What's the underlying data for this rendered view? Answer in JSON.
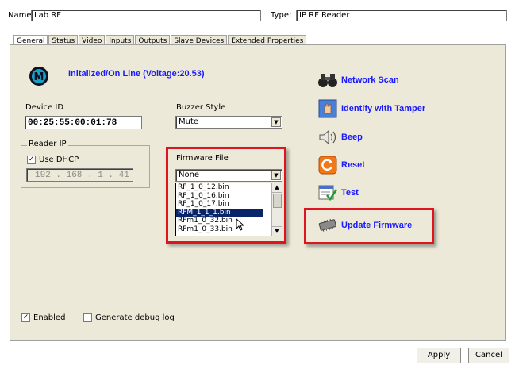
{
  "header": {
    "name_label": "Name:",
    "name_value": "Lab RF",
    "type_label": "Type:",
    "type_value": "IP RF Reader"
  },
  "tabs": [
    "General",
    "Status",
    "Video",
    "Inputs",
    "Outputs",
    "Slave Devices",
    "Extended Properties"
  ],
  "status": {
    "text": "Initalized/On Line (Voltage:20.53)"
  },
  "device": {
    "id_label": "Device ID",
    "id_value": "00:25:55:00:01:78",
    "reader_ip_label": "Reader IP",
    "dhcp_label": "Use DHCP",
    "dhcp_checked": true,
    "ip_value": "192 . 168 . 1 . 41"
  },
  "buzzer": {
    "label": "Buzzer Style",
    "value": "Mute"
  },
  "firmware": {
    "label": "Firmware File",
    "selected": "None",
    "options": [
      "RF_1_0_12.bin",
      "RF_1_0_16.bin",
      "RF_1_0_17.bin",
      "RFM_1_1_1.bin",
      "RFm1_0_32.bin",
      "RFm1_0_33.bin"
    ],
    "highlighted_index": 3
  },
  "actions": {
    "network_scan": "Network Scan",
    "identify": "Identify with Tamper",
    "beep": "Beep",
    "reset": "Reset",
    "test": "Test",
    "update_firmware": "Update Firmware"
  },
  "options": {
    "enabled_label": "Enabled",
    "enabled_checked": true,
    "debug_label": "Generate debug log",
    "debug_checked": false
  },
  "footer": {
    "apply": "Apply",
    "cancel": "Cancel"
  },
  "colors": {
    "link_blue": "#1a1aff",
    "highlight_red": "#e0141e",
    "selection_navy": "#0a246a"
  }
}
